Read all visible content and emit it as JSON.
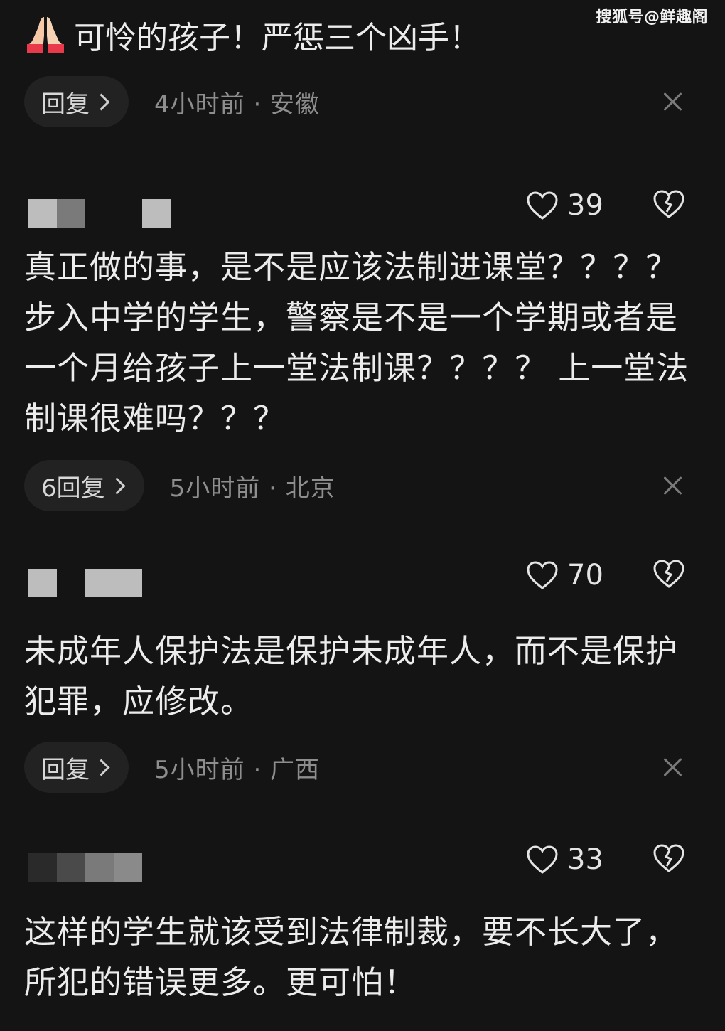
{
  "watermark": "搜狐号@鲜趣阁",
  "top_comment": {
    "emoji": "folded-hands-icon",
    "text": "可怜的孩子！严惩三个凶手！",
    "reply_label": "回复",
    "time_location": "4小时前 · 安徽"
  },
  "comments": [
    {
      "likes": "39",
      "text": "真正做的事，是不是应该法制进课堂？？？？步入中学的学生，警察是不是一个学期或者是一个月给孩子上一堂法制课？？？？ 上一堂法制课很难吗？？？",
      "reply_label": "6回复",
      "time_location": "5小时前 · 北京"
    },
    {
      "likes": "70",
      "text": "未成年人保护法是保护未成年人，而不是保护犯罪，应修改。",
      "reply_label": "回复",
      "time_location": "5小时前 · 广西"
    },
    {
      "likes": "33",
      "text": "这样的学生就该受到法律制裁，要不长大了，所犯的错误更多。更可怕！"
    }
  ],
  "colors": {
    "background": "#141414",
    "pill": "#222222",
    "text": "#ececec",
    "meta": "#8e8e8e"
  }
}
